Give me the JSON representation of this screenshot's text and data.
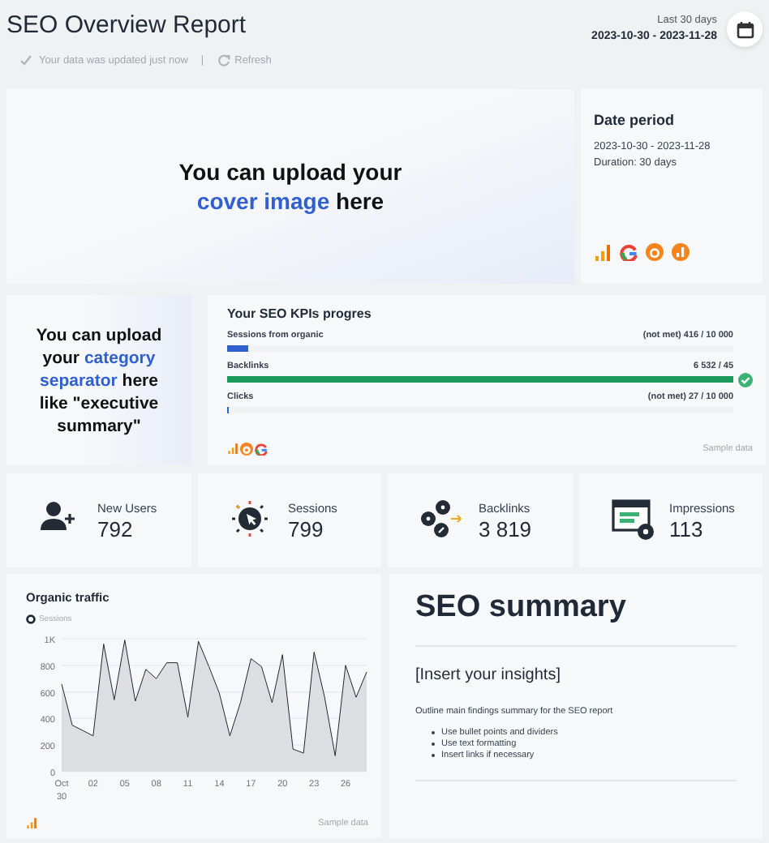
{
  "header": {
    "title": "SEO Overview Report",
    "update_note": "Your data was updated just now",
    "separator": "|",
    "refresh": "Refresh",
    "range_label": "Last 30 days",
    "range": "2023-10-30 - 2023-11-28"
  },
  "cover": {
    "parts": [
      {
        "text": "You can upload your",
        "accent": false
      },
      {
        "text": "cover image",
        "accent": true
      },
      {
        "text": "here",
        "accent": false
      }
    ],
    "period_title": "Date period",
    "period": "2023-10-30 - 2023-11-28",
    "duration": "Duration:  30 days"
  },
  "separator": {
    "parts": [
      {
        "text": "You can upload your",
        "accent": false
      },
      {
        "text": "category separator",
        "accent": true
      },
      {
        "text": "here like \"executive summary\"",
        "accent": false
      }
    ]
  },
  "kpis": {
    "title": "Your SEO KPIs progres",
    "footer": "Sample data",
    "items": [
      {
        "name": "Sessions from organic",
        "reading": "(not met) 416 / 10 000",
        "level": 0.0416,
        "met": false
      },
      {
        "name": "Backlinks",
        "reading": "6 532 / 45",
        "level": 1,
        "met": true
      },
      {
        "name": "Clicks",
        "reading": "(not met) 27 / 10 000",
        "level": 0.0027,
        "met": false
      }
    ]
  },
  "stats": [
    {
      "kind": "users",
      "label": "New Users",
      "value": "792"
    },
    {
      "kind": "sessions",
      "label": "Sessions",
      "value": "799"
    },
    {
      "kind": "backlinks",
      "label": "Backlinks",
      "value": "3 819"
    },
    {
      "kind": "impressions",
      "label": "Impressions",
      "value": "113"
    }
  ],
  "traffic": {
    "title": "Organic traffic",
    "footer": "Sample data",
    "chart_data": {
      "type": "area",
      "categories": [
        "Oct 30",
        null,
        null,
        "02",
        null,
        null,
        "05",
        null,
        null,
        "08",
        null,
        null,
        "11",
        null,
        null,
        "14",
        null,
        null,
        "17",
        null,
        null,
        "20",
        null,
        null,
        "23",
        null,
        null,
        "26",
        null,
        null
      ],
      "grid": true,
      "series": [
        {
          "name": "Sessions",
          "color": "#1f2937",
          "values": [
            660,
            350,
            310,
            270,
            960,
            540,
            990,
            530,
            770,
            700,
            820,
            820,
            410,
            980,
            790,
            590,
            270,
            520,
            850,
            790,
            520,
            880,
            170,
            140,
            900,
            560,
            120,
            800,
            560,
            750
          ]
        }
      ],
      "ylim": [
        0,
        1000
      ],
      "yticks": [
        0,
        200,
        400,
        600,
        800,
        {
          "value": 1000,
          "label": "1K"
        }
      ]
    }
  },
  "summary": {
    "title": "SEO summary",
    "heading": "[Insert your insights]",
    "text": "Outline main findings summary for the SEO report",
    "bullets": [
      "Use bullet points and dividers",
      "Use text formatting",
      "Insert links if necessary"
    ]
  }
}
